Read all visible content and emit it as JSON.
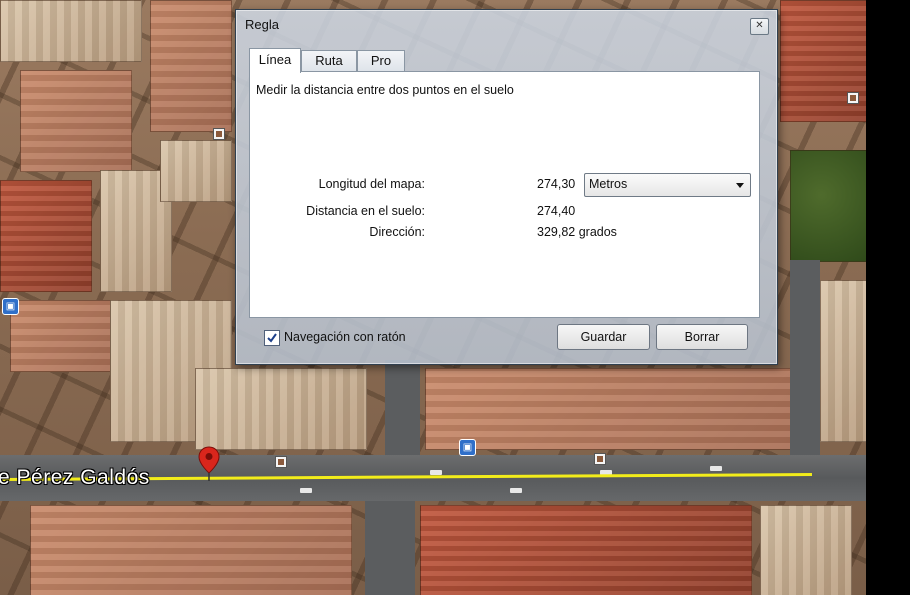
{
  "map": {
    "street_label": "e Pérez Galdós",
    "pin_icon": "location-pin-icon",
    "measure_line_color": "#f2ec1a"
  },
  "dialog": {
    "title": "Regla",
    "close_label": "✕",
    "tabs": [
      {
        "label": "Línea",
        "active": true
      },
      {
        "label": "Ruta",
        "active": false
      },
      {
        "label": "Pro",
        "active": false
      }
    ],
    "description": "Medir la distancia entre dos puntos en el suelo",
    "map_length_label": "Longitud del mapa:",
    "map_length_value": "274,30",
    "unit_selected": "Metros",
    "ground_distance_label": "Distancia en el suelo:",
    "ground_distance_value": "274,40",
    "direction_label": "Dirección:",
    "direction_value": "329,82 grados",
    "mouse_nav_label": "Navegación con ratón",
    "mouse_nav_checked": true,
    "save_label": "Guardar",
    "clear_label": "Borrar"
  }
}
